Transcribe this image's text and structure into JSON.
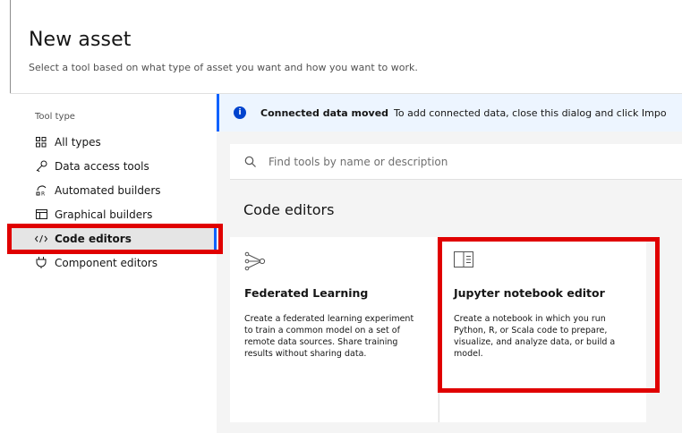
{
  "header": {
    "title": "New asset",
    "subtitle": "Select a tool based on what type of asset you want and how you want to work."
  },
  "sidebar": {
    "label": "Tool type",
    "items": [
      {
        "label": "All types",
        "icon": "grid-icon"
      },
      {
        "label": "Data access tools",
        "icon": "key-icon"
      },
      {
        "label": "Automated builders",
        "icon": "automated-builder-icon"
      },
      {
        "label": "Graphical builders",
        "icon": "graphical-builder-icon"
      },
      {
        "label": "Code editors",
        "icon": "code-icon",
        "active": true
      },
      {
        "label": "Component editors",
        "icon": "plug-icon"
      }
    ]
  },
  "notice": {
    "title": "Connected data moved",
    "text": "To add connected data, close this dialog and click Impo"
  },
  "search": {
    "placeholder": "Find tools by name or description"
  },
  "section": {
    "title": "Code editors"
  },
  "cards": [
    {
      "title": "Federated Learning",
      "description": "Create a federated learning experiment to train a common model on a set of remote data sources. Share training results without sharing data.",
      "icon": "federated-learning-icon"
    },
    {
      "title": "Jupyter notebook editor",
      "description": "Create a notebook in which you run Python, R, or Scala code to prepare, visualize, and analyze data, or build a model.",
      "icon": "notebook-icon"
    }
  ],
  "colors": {
    "accent": "#0f62fe",
    "highlight": "#e00000",
    "info": "#0043ce"
  }
}
